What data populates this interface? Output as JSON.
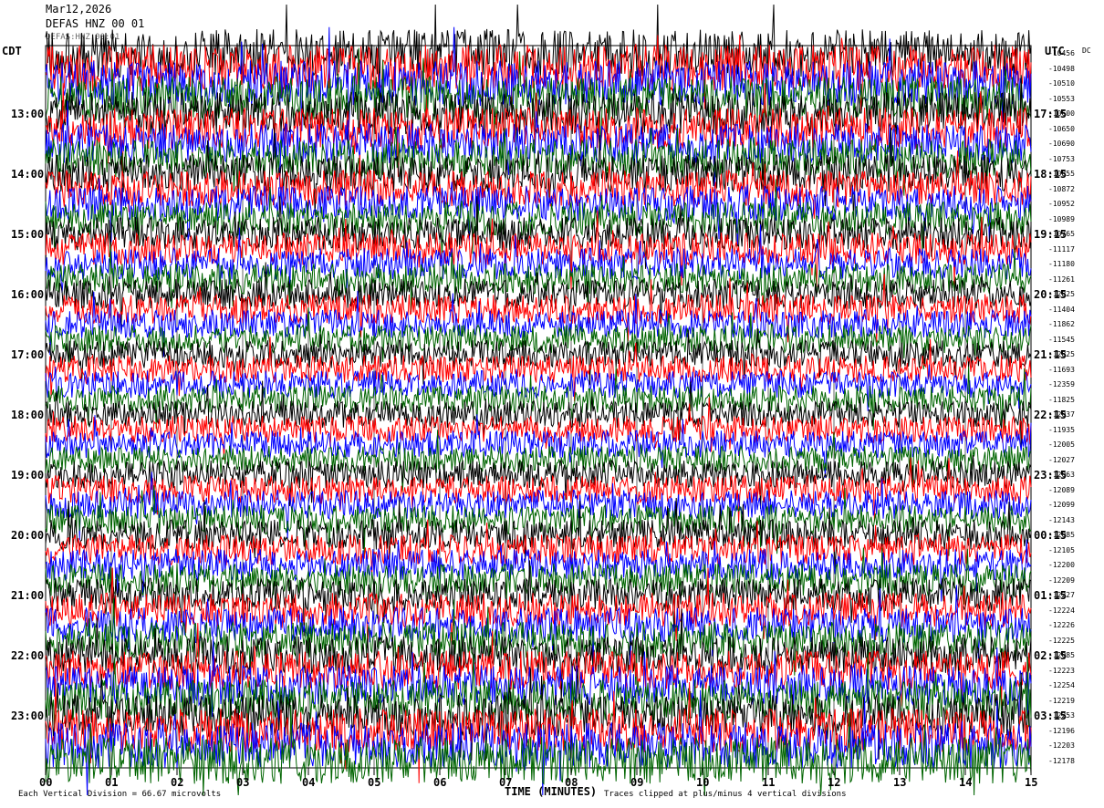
{
  "header": {
    "date": "Mar12,2026",
    "station": "DEFAS HNZ 00 01",
    "sub": "DEFAS:HNZ:00:01"
  },
  "axis_labels": {
    "left_title": "CDT",
    "right_title": "UTC",
    "dc_title": "DC",
    "x_title": "TIME (MINUTES)"
  },
  "footer": {
    "division": "Each Vertical Division =   66.67 microvolts",
    "clip": "Traces clipped at plus/minus 4 vertical divisions"
  },
  "colors": {
    "trace_cycle": [
      "#000000",
      "#ff0000",
      "#0000ff",
      "#006400"
    ],
    "background": "#ffffff",
    "gridline": "#000000"
  },
  "chart_data": {
    "type": "line",
    "title": "",
    "xlabel": "TIME (MINUTES)",
    "ylabel": "",
    "xlim": [
      0,
      15
    ],
    "x_ticks": [
      "00",
      "01",
      "02",
      "03",
      "04",
      "05",
      "06",
      "07",
      "08",
      "09",
      "10",
      "11",
      "12",
      "13",
      "14",
      "15"
    ],
    "y_ticks_left": [
      "13:00",
      "14:00",
      "15:00",
      "16:00",
      "17:00",
      "18:00",
      "19:00",
      "20:00",
      "21:00",
      "22:00",
      "23:00"
    ],
    "y_ticks_right": [
      "17:15",
      "18:15",
      "19:15",
      "20:15",
      "21:15",
      "22:15",
      "23:15",
      "00:15",
      "01:15",
      "02:15",
      "03:15"
    ],
    "traces_per_hour": 4,
    "trace_count": 48,
    "trace_minutes": 15,
    "clip_divisions": 4,
    "dc_offsets": [
      "-10456",
      "-10498",
      "-10510",
      "-10553",
      "-10600",
      "-10650",
      "-10690",
      "-10753",
      "-10855",
      "-10872",
      "-10952",
      "-10989",
      "-10765",
      "-11117",
      "-11180",
      "-11261",
      "-12825",
      "-11404",
      "-11862",
      "-11545",
      "-12825",
      "-11693",
      "-12359",
      "-11825",
      "-12037",
      "-11935",
      "-12005",
      "-12027",
      "-12063",
      "-12089",
      "-12099",
      "-12143",
      "-12085",
      "-12105",
      "-12200",
      "-12209",
      "-12227",
      "-12224",
      "-12226",
      "-12225",
      "-12085",
      "-12223",
      "-12254",
      "-12219",
      "-12253",
      "-12196",
      "-12203",
      "-12178"
    ]
  }
}
